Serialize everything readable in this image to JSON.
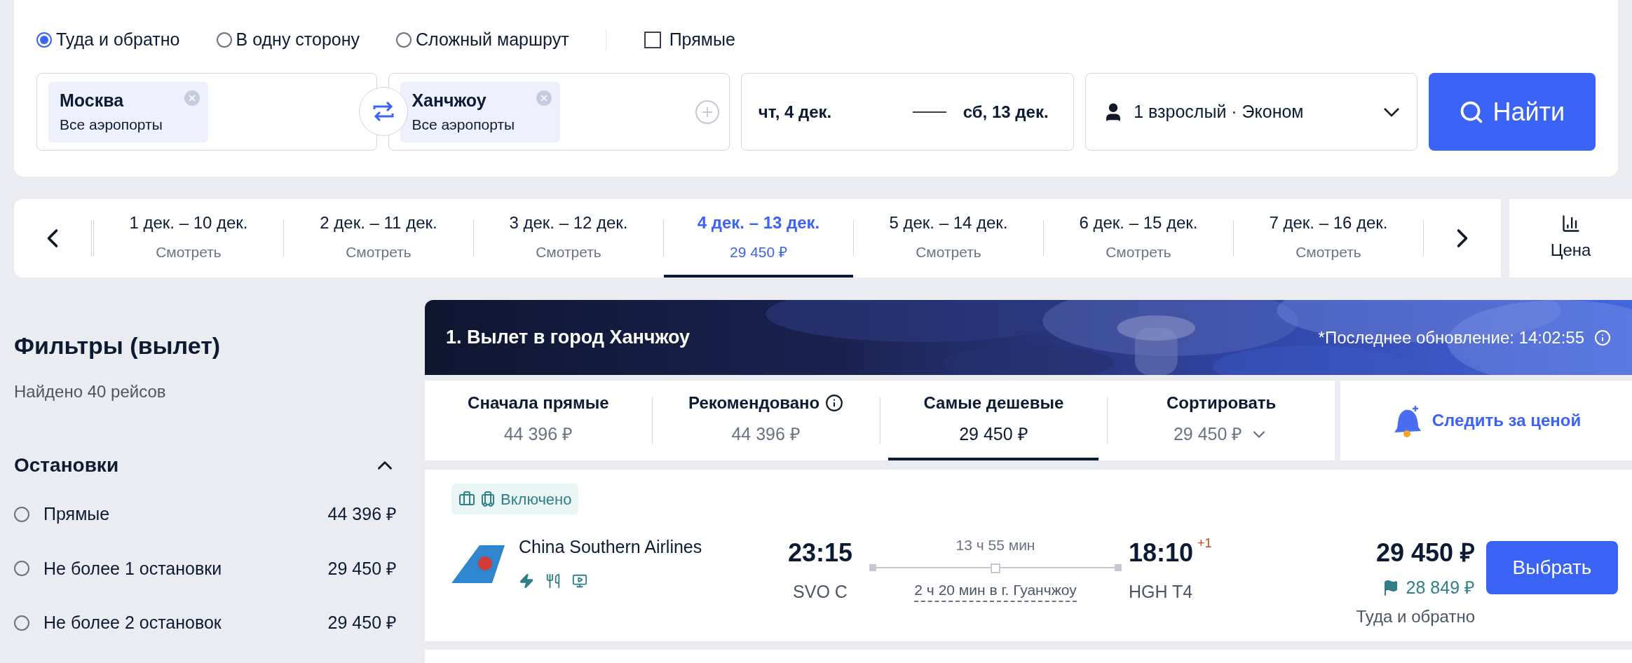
{
  "trip_types": [
    {
      "label": "Туда и обратно",
      "selected": true
    },
    {
      "label": "В одну сторону",
      "selected": false
    },
    {
      "label": "Сложный маршрут",
      "selected": false
    }
  ],
  "direct_only": {
    "label": "Прямые",
    "checked": false
  },
  "origin": {
    "city": "Москва",
    "airports": "Все аэропорты"
  },
  "destination": {
    "city": "Ханчжоу",
    "airports": "Все аэропорты"
  },
  "dates": {
    "depart": "чт, 4 дек.",
    "return": "сб, 13 дек."
  },
  "passengers": "1 взрослый · Эконом",
  "search_button": "Найти",
  "date_options": [
    {
      "dates": "1 дек. – 10 дек.",
      "price": "Смотреть",
      "selected": false
    },
    {
      "dates": "2 дек. – 11 дек.",
      "price": "Смотреть",
      "selected": false
    },
    {
      "dates": "3 дек. – 12 дек.",
      "price": "Смотреть",
      "selected": false
    },
    {
      "dates": "4 дек. – 13 дек.",
      "price": "29 450 ₽",
      "selected": true
    },
    {
      "dates": "5 дек. – 14 дек.",
      "price": "Смотреть",
      "selected": false
    },
    {
      "dates": "6 дек. – 15 дек.",
      "price": "Смотреть",
      "selected": false
    },
    {
      "dates": "7 дек. – 16 дек.",
      "price": "Смотреть",
      "selected": false
    }
  ],
  "price_chart_button": "Цена",
  "filters": {
    "title": "Фильтры (вылет)",
    "found": "Найдено 40 рейсов",
    "stops": {
      "title": "Остановки",
      "expanded": true,
      "options": [
        {
          "label": "Прямые",
          "price": "44 396 ₽",
          "selected": false
        },
        {
          "label": "Не более 1 остановки",
          "price": "29 450 ₽",
          "selected": false
        },
        {
          "label": "Не более 2 остановок",
          "price": "29 450 ₽",
          "selected": false
        }
      ]
    }
  },
  "results": {
    "title": "1. Вылет в город Ханчжоу",
    "updated": "*Последнее обновление: 14:02:55",
    "sort_tabs": [
      {
        "kind": "plain",
        "label": "Сначала прямые",
        "price": "44 396 ₽",
        "selected": false
      },
      {
        "kind": "info",
        "label": "Рекомендовано",
        "price": "44 396 ₽",
        "selected": false
      },
      {
        "kind": "plain",
        "label": "Самые дешевые",
        "price": "29 450 ₽",
        "selected": true
      },
      {
        "kind": "dropdown",
        "label": "Сортировать",
        "price": "29 450 ₽",
        "selected": false
      }
    ],
    "price_alert": "Следить за ценой",
    "flights": [
      {
        "baggage": "Включено",
        "airline": "China Southern Airlines",
        "depart_time": "23:15",
        "depart_airport": "SVO C",
        "duration": "13 ч 55 мин",
        "stopover": "2 ч 20 мин в г. Гуанчжоу",
        "arrive_time": "18:10",
        "day_offset": "+1",
        "arrive_airport": "HGH T4",
        "price": "29 450 ₽",
        "alt_price": "28 849 ₽",
        "price_note": "Туда и обратно",
        "button": "Выбрать"
      }
    ]
  }
}
